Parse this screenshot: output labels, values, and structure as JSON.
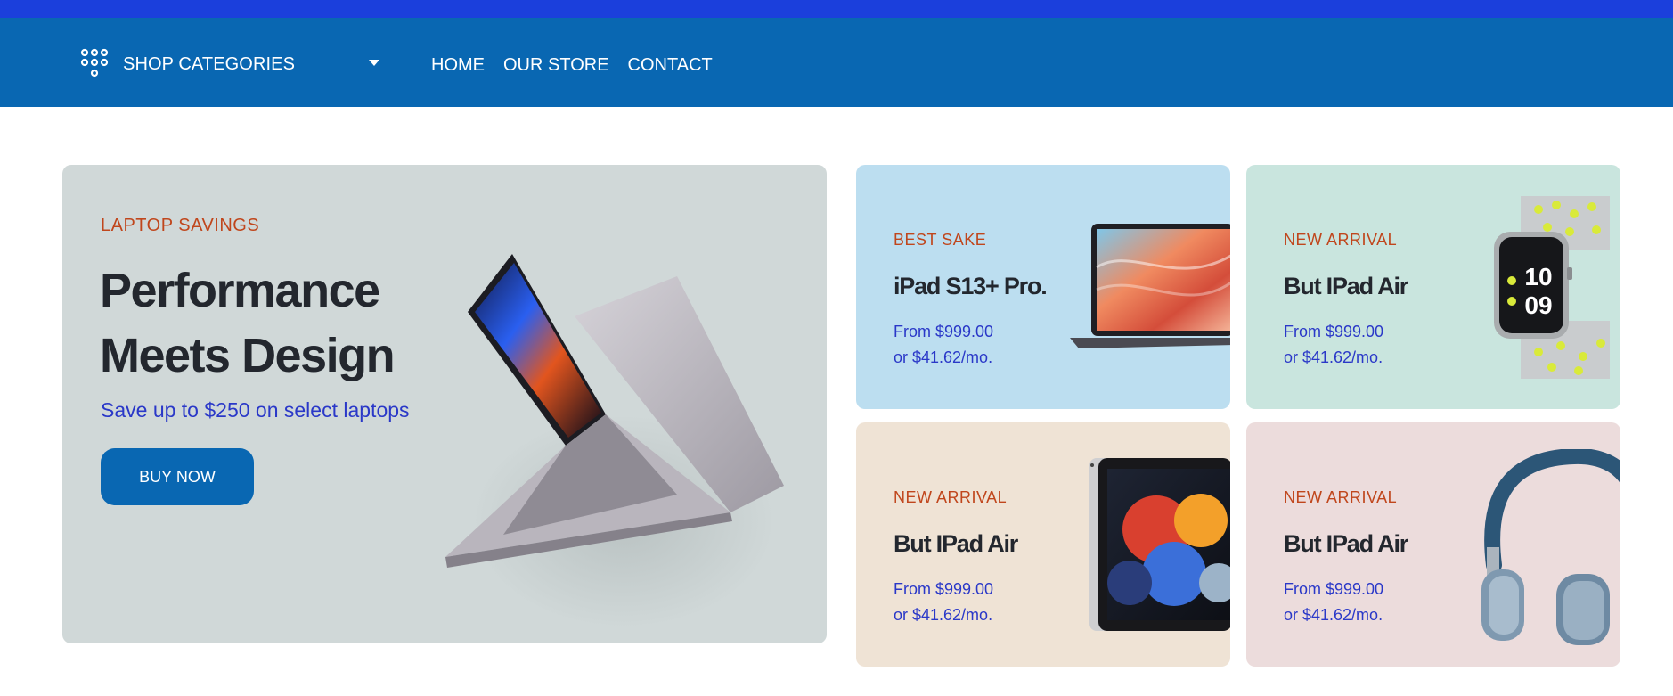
{
  "nav": {
    "categories_label": "SHOP CATEGORIES",
    "links": [
      "HOME",
      "OUR STORE",
      "CONTACT"
    ]
  },
  "hero": {
    "eyebrow": "LAPTOP SAVINGS",
    "headline": "Performance Meets Design",
    "subtitle": "Save up to $250 on select laptops",
    "button": "BUY NOW",
    "image_icon": "laptop-image"
  },
  "promos": [
    {
      "tag": "BEST SAKE",
      "title": "iPad S13+ Pro.",
      "price_line1": "From $999.00",
      "price_line2": "or $41.62/mo.",
      "image_icon": "laptop-image"
    },
    {
      "tag": "NEW ARRIVAL",
      "title": "But IPad Air",
      "price_line1": "From $999.00",
      "price_line2": "or $41.62/mo.",
      "image_icon": "watch-image"
    },
    {
      "tag": "NEW ARRIVAL",
      "title": "But IPad Air",
      "price_line1": "From $999.00",
      "price_line2": "or $41.62/mo.",
      "image_icon": "tablet-image"
    },
    {
      "tag": "NEW ARRIVAL",
      "title": "But IPad Air",
      "price_line1": "From $999.00",
      "price_line2": "or $41.62/mo.",
      "image_icon": "headphones-image"
    }
  ],
  "watch_face": {
    "time_hour": "10",
    "time_min": "09"
  },
  "colors": {
    "top_strip": "#1b3fdc",
    "navbar": "#0967b2",
    "accent_orange": "#c0461c",
    "accent_blue": "#2a38c8"
  }
}
